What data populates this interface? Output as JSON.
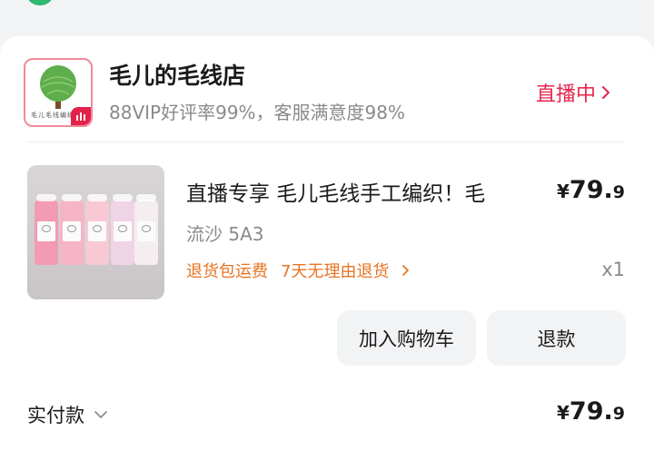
{
  "shop": {
    "name": "毛儿的毛线店",
    "meta": "88VIP好评率99%，客服满意度98%",
    "logo_text": "毛儿毛线编织",
    "live_label": "直播中"
  },
  "product": {
    "title": "直播专享 毛儿毛线手工编织！毛",
    "spec": "流沙 5A3",
    "return_policy": "退货包运费",
    "return_reason": "7天无理由退货",
    "price_symbol": "¥",
    "price_int": "79.",
    "price_dec": "9",
    "quantity": "x1"
  },
  "actions": {
    "add_to_cart": "加入购物车",
    "refund": "退款"
  },
  "payment": {
    "label": "实付款",
    "price_symbol": "¥",
    "price_int": "79.",
    "price_dec": "9"
  },
  "colors": {
    "accent_red": "#e6264d",
    "return_orange": "#e87422",
    "logo_green": "#5fae4d"
  },
  "icons": {
    "live_chevron": "chevron-right-icon",
    "return_chevron": "chevron-right-icon",
    "payment_chevron": "chevron-down-icon"
  }
}
